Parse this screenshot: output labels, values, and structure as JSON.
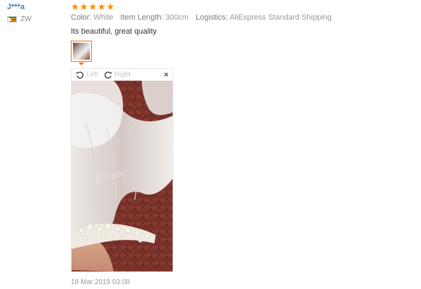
{
  "reviewer": {
    "name": "J***a",
    "country": "ZW",
    "flag_icon": "zimbabwe-flag-icon"
  },
  "review": {
    "rating": 5,
    "star_icon": "star-icon",
    "star_color": "#ff8a00",
    "attributes": [
      {
        "label": "Color:",
        "value": "White"
      },
      {
        "label": "Item Length:",
        "value": "300cm"
      },
      {
        "label": "Logistics:",
        "value": "AliExpress Standard Shipping"
      }
    ],
    "feedback": "Its beautiful, great quality",
    "date": "18 Mar 2019 03:08"
  },
  "viewer": {
    "rotate_left_label": "Left",
    "rotate_right_label": "Right",
    "close_symbol": "×",
    "watermark": "Fluney",
    "accent_color": "#ff6a00"
  }
}
